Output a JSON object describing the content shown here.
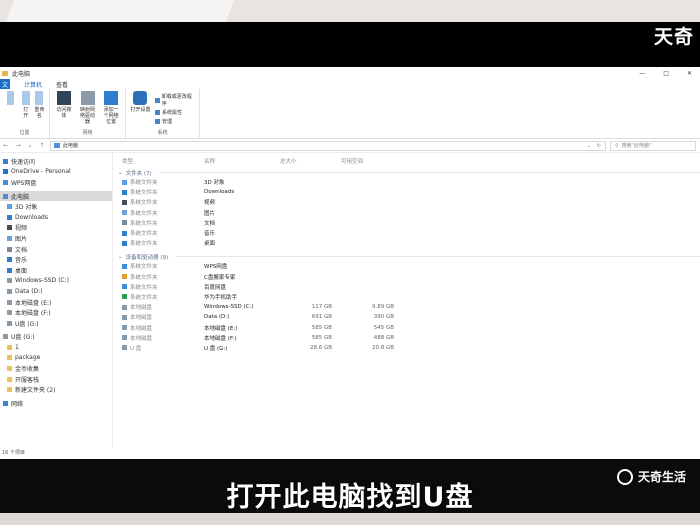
{
  "brand_top": "天奇",
  "brand_bottom": "天奇生活",
  "subtitle": "打开此电脑找到U盘",
  "window": {
    "title": "此电脑",
    "controls": [
      "—",
      "□",
      "✕"
    ]
  },
  "ribbon": {
    "file_tab": "文",
    "tabs": [
      "计算机",
      "查看"
    ],
    "groups": [
      {
        "label": "位置",
        "items": [
          "属性",
          "打开",
          "重命名"
        ]
      },
      {
        "label": "网络",
        "items": [
          "访问媒体",
          "映射网络驱动器",
          "添加一个网络位置"
        ]
      },
      {
        "label": "系统",
        "items": [
          "打开设置"
        ],
        "list": [
          "卸载或更改程序",
          "系统属性",
          "管理"
        ]
      }
    ]
  },
  "address": {
    "path": "此电脑",
    "search_placeholder": "搜索\"此电脑\""
  },
  "nav": {
    "items": [
      {
        "label": "快速访问",
        "color": "#3c7fd1"
      },
      {
        "label": "OneDrive - Personal",
        "color": "#1b76d1"
      },
      {
        "label": "WPS网盘",
        "color": "#3e8de0"
      },
      {
        "label": "此电脑",
        "color": "#4f8ed6",
        "selected": true
      },
      {
        "label": "3D 对象",
        "color": "#5aa0e8"
      },
      {
        "label": "Downloads",
        "color": "#2f7dd1"
      },
      {
        "label": "视频",
        "color": "#444c55"
      },
      {
        "label": "图片",
        "color": "#6aa3d8"
      },
      {
        "label": "文档",
        "color": "#7a8a9a"
      },
      {
        "label": "音乐",
        "color": "#2f7dd1"
      },
      {
        "label": "桌面",
        "color": "#2f7dd1"
      },
      {
        "label": "Windows-SSD (C:)",
        "color": "#8a9aa8"
      },
      {
        "label": "Data (D:)",
        "color": "#8a9aa8"
      },
      {
        "label": "本地磁盘 (E:)",
        "color": "#8a9aa8"
      },
      {
        "label": "本地磁盘 (F:)",
        "color": "#8a9aa8"
      },
      {
        "label": "U盘 (G:)",
        "color": "#8a9aa8"
      },
      {
        "label": "U盘 (G:)",
        "color": "#8a9aa8"
      },
      {
        "label": "1",
        "color": "#e8c35a"
      },
      {
        "label": "package",
        "color": "#e8c35a"
      },
      {
        "label": "金币收集",
        "color": "#e8c35a"
      },
      {
        "label": "开服客栈",
        "color": "#e8c35a"
      },
      {
        "label": "新建文件夹 (2)",
        "color": "#e8c35a"
      },
      {
        "label": "网络",
        "color": "#3c7fd1"
      }
    ]
  },
  "columns": [
    "类型",
    "名称",
    "总大小",
    "可用空间"
  ],
  "sections": [
    {
      "label": "文件夹 (7)",
      "rows": [
        {
          "type": "系统文件夹",
          "name": "3D 对象",
          "total": "",
          "free": "",
          "color": "#5aa0e8"
        },
        {
          "type": "系统文件夹",
          "name": "Downloads",
          "total": "",
          "free": "",
          "color": "#2f7dd1"
        },
        {
          "type": "系统文件夹",
          "name": "视频",
          "total": "",
          "free": "",
          "color": "#444c55"
        },
        {
          "type": "系统文件夹",
          "name": "图片",
          "total": "",
          "free": "",
          "color": "#6aa3d8"
        },
        {
          "type": "系统文件夹",
          "name": "文档",
          "total": "",
          "free": "",
          "color": "#7a8a9a"
        },
        {
          "type": "系统文件夹",
          "name": "音乐",
          "total": "",
          "free": "",
          "color": "#2f7dd1"
        },
        {
          "type": "系统文件夹",
          "name": "桌面",
          "total": "",
          "free": "",
          "color": "#2f7dd1"
        }
      ]
    },
    {
      "label": "设备和驱动器 (9)",
      "rows": [
        {
          "type": "系统文件夹",
          "name": "WPS网盘",
          "total": "",
          "free": "",
          "color": "#3e8de0"
        },
        {
          "type": "系统文件夹",
          "name": "C盘搬家专家",
          "total": "",
          "free": "",
          "color": "#e0a030"
        },
        {
          "type": "系统文件夹",
          "name": "百度网盘",
          "total": "",
          "free": "",
          "color": "#3e8de0"
        },
        {
          "type": "系统文件夹",
          "name": "华为手机助手",
          "total": "",
          "free": "",
          "color": "#2ca14a"
        },
        {
          "type": "本地磁盘",
          "name": "Windows-SSD (C:)",
          "total": "117 GB",
          "free": "9.89 GB",
          "color": "#8a9aa8"
        },
        {
          "type": "本地磁盘",
          "name": "Data (D:)",
          "total": "691 GB",
          "free": "390 GB",
          "color": "#8a9aa8"
        },
        {
          "type": "本地磁盘",
          "name": "本地磁盘 (E:)",
          "total": "585 GB",
          "free": "545 GB",
          "color": "#8a9aa8"
        },
        {
          "type": "本地磁盘",
          "name": "本地磁盘 (F:)",
          "total": "585 GB",
          "free": "488 GB",
          "color": "#8a9aa8"
        },
        {
          "type": "U 盘",
          "name": "U 盘 (G:)",
          "total": "28.6 GB",
          "free": "20.8 GB",
          "color": "#8a9aa8"
        }
      ]
    }
  ],
  "status": "16 个项目"
}
